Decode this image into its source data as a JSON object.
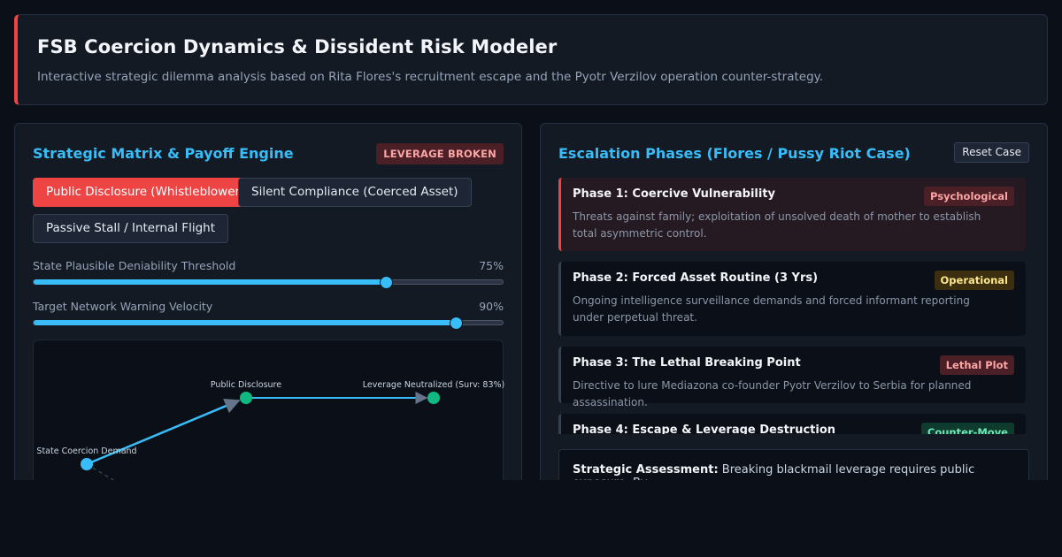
{
  "header": {
    "title": "FSB Coercion Dynamics & Dissident Risk Modeler",
    "subtitle": "Interactive strategic dilemma analysis based on Rita Flores's recruitment escape and the Pyotr Verzilov operation counter-strategy."
  },
  "left": {
    "title": "Strategic Matrix & Payoff Engine",
    "status_badge": "LEVERAGE BROKEN",
    "strategies": [
      {
        "label": "Public Disclosure (Whistleblower)",
        "active": true
      },
      {
        "label": "Silent Compliance (Coerced Asset)",
        "active": false
      },
      {
        "label": "Passive Stall / Internal Flight",
        "active": false
      }
    ],
    "sliders": [
      {
        "label": "State Plausible Deniability Threshold",
        "value_text": "75%",
        "value": 0.75
      },
      {
        "label": "Target Network Warning Velocity",
        "value_text": "90%",
        "value": 0.9
      }
    ],
    "graph": {
      "nodes": [
        {
          "label": "State Coercion Demand",
          "color": "#38bdf8"
        },
        {
          "label": "Public Disclosure",
          "color": "#10b981"
        },
        {
          "label": "Leverage Neutralized (Surv: 83%)",
          "color": "#10b981"
        }
      ]
    }
  },
  "right": {
    "title": "Escalation Phases (Flores / Pussy Riot Case)",
    "reset_label": "Reset Case",
    "phases": [
      {
        "title": "Phase 1: Coercive Vulnerability",
        "tag": "Psychological",
        "desc": "Threats against family; exploitation of unsolved death of mother to establish total asymmetric control."
      },
      {
        "title": "Phase 2: Forced Asset Routine (3 Yrs)",
        "tag": "Operational",
        "desc": "Ongoing intelligence surveillance demands and forced informant reporting under perpetual threat."
      },
      {
        "title": "Phase 3: The Lethal Breaking Point",
        "tag": "Lethal Plot",
        "desc": "Directive to lure Mediazona co-founder Pyotr Verzilov to Serbia for planned assassination."
      },
      {
        "title": "Phase 4: Escape & Leverage Destruction",
        "tag": "Counter-Move",
        "desc": ""
      }
    ],
    "assessment": {
      "label": "Strategic Assessment:",
      "text": "Breaking blackmail leverage requires public exposure. By"
    }
  },
  "colors": {
    "accent": "#38bdf8",
    "danger": "#ef4444",
    "success": "#10b981"
  }
}
